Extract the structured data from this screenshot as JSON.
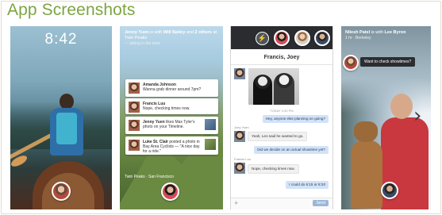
{
  "page": {
    "title": "App Screenshots"
  },
  "lock": {
    "time": "8:42"
  },
  "cover": {
    "header_name": "Jenny Yuen",
    "header_with": "is with",
    "header_friend": "Will Bailey",
    "header_and": "and",
    "header_others": "2 others",
    "header_at": "at Twin Peaks",
    "header_sub": "— taking in the view",
    "footer": "Twin Peaks · San Francisco",
    "notifications": [
      {
        "name": "Amanda Johnson",
        "text": "Wanna grab dinner around 7pm?"
      },
      {
        "name": "Francis Luu",
        "text": "Nope, checking times now."
      },
      {
        "name": "Jenny Yuen",
        "text": "likes Max Tyler's photo on your Timeline."
      },
      {
        "name": "Luke St. Clair",
        "text": "posted a photo in Bay Area Cyclists — \"A nice day for a ride.\""
      }
    ]
  },
  "chat": {
    "title": "Francis, Joey",
    "messenger_icon": "messenger-bolt-icon",
    "timestamp": "TODAY 4:30 PM",
    "messages": [
      {
        "from": "me",
        "text": "Hey, anyone else planning on going?"
      },
      {
        "from": "them",
        "sender": "Joey Yuen",
        "text": "Yeah, Leo said he wanted to go."
      },
      {
        "from": "me",
        "text": "Did we decide on an actual showtime yet?"
      },
      {
        "from": "them",
        "sender": "Francis Luu",
        "text": "Nope, checking times now."
      },
      {
        "from": "me",
        "text": "I could do 6:15 or 8:20"
      }
    ],
    "send_label": "Send",
    "add_label": "+"
  },
  "cover2": {
    "header_name": "Nilesh Patel",
    "header_with": "is with",
    "header_friend": "Lee Byron",
    "header_sub": "1 hr · Berkeley",
    "chat_text": "Want to check showtimes?"
  },
  "nav": {
    "next_icon": "chevron-right-icon",
    "next_glyph": "›"
  },
  "colors": {
    "heading": "#7ca541",
    "chat_bar": "#2a2c30",
    "my_bubble": "#d2e3f8"
  }
}
